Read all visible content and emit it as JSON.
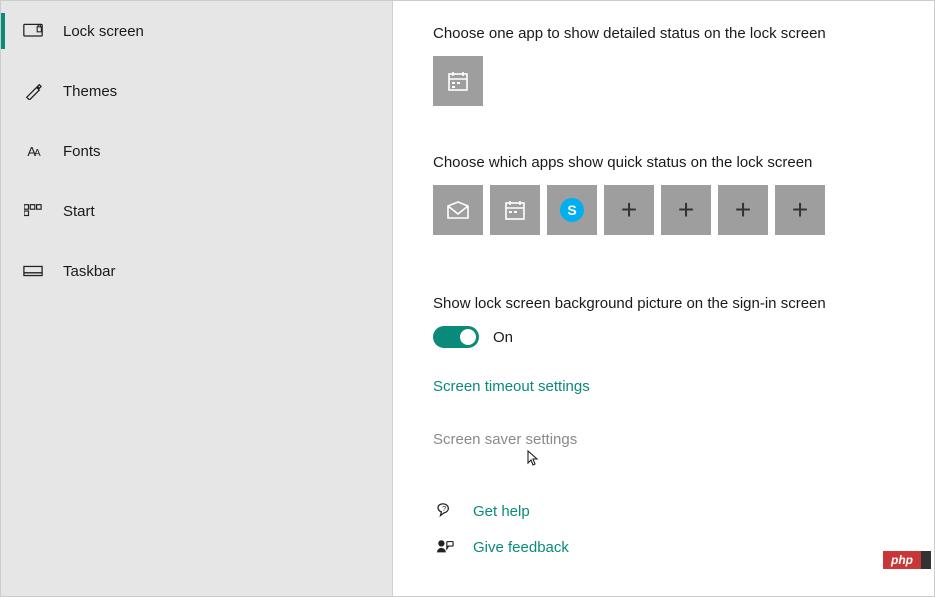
{
  "sidebar": {
    "items": [
      {
        "key": "lock-screen",
        "label": "Lock screen",
        "selected": true
      },
      {
        "key": "themes",
        "label": "Themes",
        "selected": false
      },
      {
        "key": "fonts",
        "label": "Fonts",
        "selected": false
      },
      {
        "key": "start",
        "label": "Start",
        "selected": false
      },
      {
        "key": "taskbar",
        "label": "Taskbar",
        "selected": false
      }
    ]
  },
  "sections": {
    "detailed_status_label": "Choose one app to show detailed status on the lock screen",
    "detailed_status_app": "calendar",
    "quick_status_label": "Choose which apps show quick status on the lock screen",
    "quick_status_apps": [
      "mail",
      "calendar",
      "skype",
      "add",
      "add",
      "add",
      "add"
    ],
    "signin_bg_label": "Show lock screen background picture on the sign-in screen",
    "signin_bg_state": "On",
    "signin_bg_toggle": true,
    "link_timeout": "Screen timeout settings",
    "link_screensaver": "Screen saver settings"
  },
  "help": {
    "get_help": "Get help",
    "feedback": "Give feedback"
  },
  "colors": {
    "accent": "#0a8b7a",
    "tile": "#9e9e9e",
    "skype": "#00aff0"
  },
  "watermark": "php"
}
